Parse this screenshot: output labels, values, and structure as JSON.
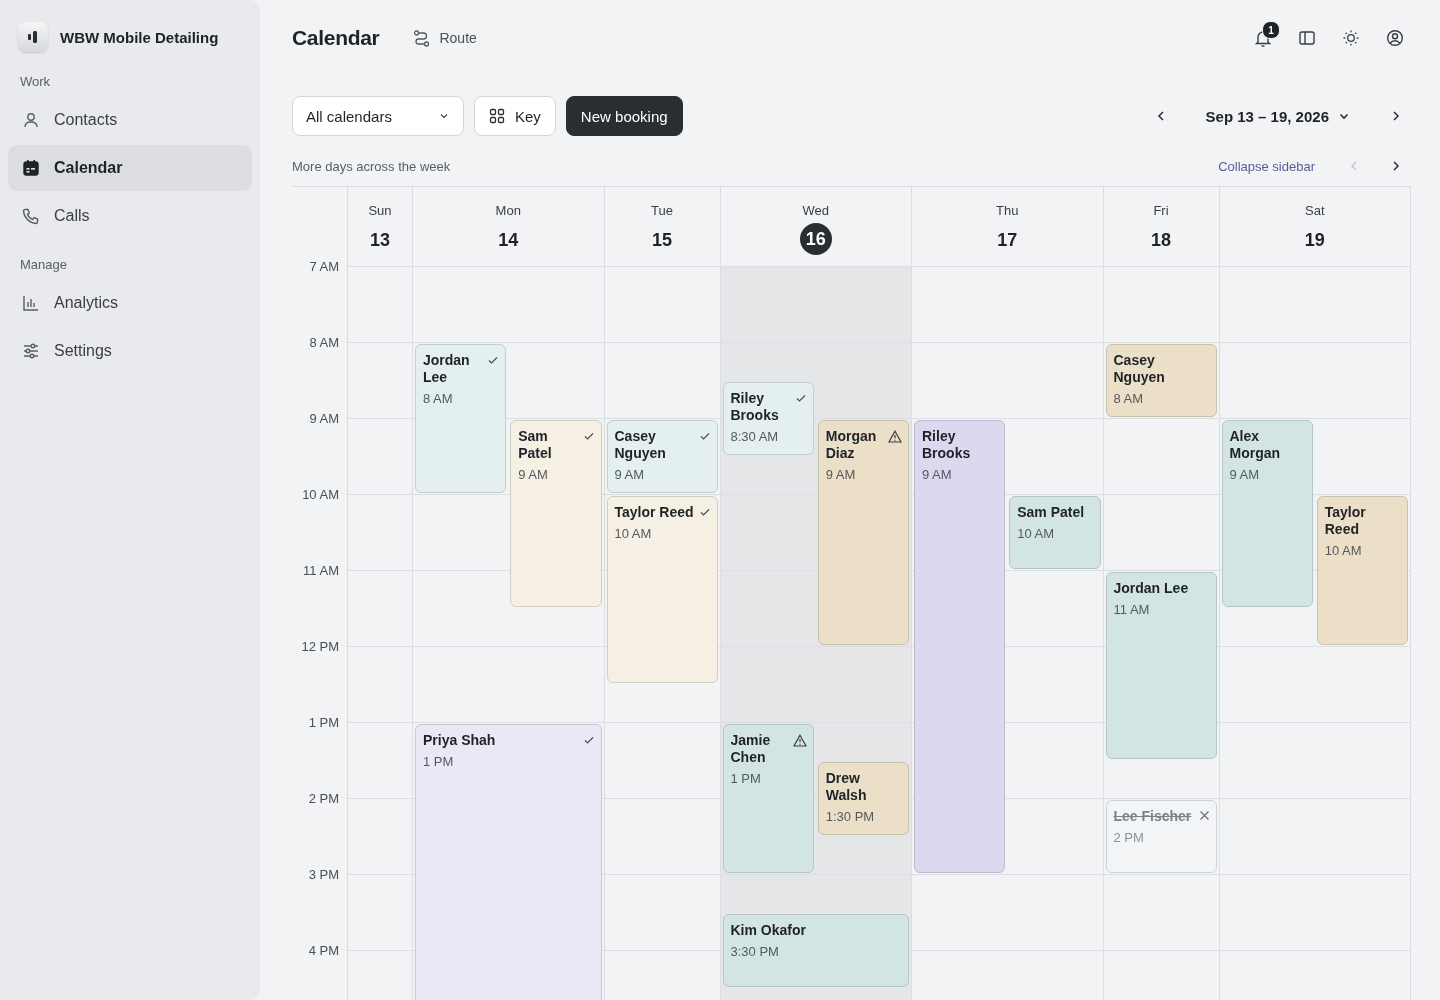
{
  "sidebar": {
    "brand": "WBW Mobile Detailing",
    "sections": [
      {
        "label": "Work",
        "items": [
          {
            "label": "Contacts",
            "selected": false
          },
          {
            "label": "Calendar",
            "selected": true
          },
          {
            "label": "Calls",
            "selected": false
          }
        ]
      },
      {
        "label": "Manage",
        "items": [
          {
            "label": "Analytics",
            "selected": false
          },
          {
            "label": "Settings",
            "selected": false
          }
        ]
      }
    ]
  },
  "header": {
    "title": "Calendar",
    "route_link": "Route",
    "notification_count": "1"
  },
  "toolbar": {
    "calendar_select": "All calendars",
    "key_button": "Key",
    "new_button": "New booking",
    "date_range": "Sep 13 – 19, 2026"
  },
  "subheader": {
    "note": "More days across the week",
    "collapse_link": "Collapse sidebar",
    "prev_disabled": true
  },
  "hours": [
    "7 AM",
    "8 AM",
    "9 AM",
    "10 AM",
    "11 AM",
    "12 PM",
    "1 PM",
    "2 PM",
    "3 PM",
    "4 PM"
  ],
  "days": [
    {
      "weekday": "Sun",
      "date": "13",
      "selected": false
    },
    {
      "weekday": "Mon",
      "date": "14",
      "selected": false,
      "events": [
        {
          "name": "Jordan Lee",
          "time": "8 AM",
          "kind": "confirmed",
          "color": "#e4eff0"
        },
        {
          "name": "Sam Patel",
          "time": "9 AM",
          "kind": "confirmed",
          "color": "#f5efe4"
        },
        {
          "name": "Priya Shah",
          "time": "1 PM",
          "kind": "confirmed",
          "color": "#ebe8f6"
        }
      ]
    },
    {
      "weekday": "Tue",
      "date": "15",
      "selected": false,
      "events": [
        {
          "name": "Casey Nguyen",
          "time": "9 AM",
          "kind": "confirmed",
          "color": "#e4eff0"
        },
        {
          "name": "Taylor Reed",
          "time": "10 AM",
          "kind": "confirmed",
          "color": "#f5efe4"
        }
      ]
    },
    {
      "weekday": "Wed",
      "date": "16",
      "selected": true,
      "events": [
        {
          "name": "Riley Brooks",
          "time": "8:30 AM",
          "kind": "confirmed",
          "color": "#e4eff0"
        },
        {
          "name": "Morgan Diaz",
          "time": "9 AM",
          "kind": "warning",
          "color": "#ecdfc8"
        },
        {
          "name": "Jamie Chen",
          "time": "1 PM",
          "kind": "warning",
          "color": "#d3e5e3"
        },
        {
          "name": "Drew Walsh",
          "time": "1:30 PM",
          "kind": "plain",
          "color": "#ecdfc8"
        },
        {
          "name": "Kim Okafor",
          "time": "3:30 PM",
          "kind": "plain",
          "color": "#d3e5e3"
        }
      ]
    },
    {
      "weekday": "Thu",
      "date": "17",
      "selected": false,
      "events": [
        {
          "name": "Riley Brooks",
          "time": "9 AM",
          "kind": "plain",
          "color": "#ddd7ef"
        },
        {
          "name": "Sam Patel",
          "time": "10 AM",
          "kind": "plain",
          "color": "#d3e5e3"
        }
      ]
    },
    {
      "weekday": "Fri",
      "date": "18",
      "selected": false,
      "events": [
        {
          "name": "Casey Nguyen",
          "time": "8 AM",
          "kind": "plain",
          "color": "#ecdfc8"
        },
        {
          "name": "Jordan Lee",
          "time": "11 AM",
          "kind": "plain",
          "color": "#d3e5e3"
        },
        {
          "name": "Lee Fischer",
          "time": "2 PM",
          "kind": "cancelled",
          "color": "#f3f4f6"
        }
      ]
    },
    {
      "weekday": "Sat",
      "date": "19",
      "selected": false,
      "events": [
        {
          "name": "Alex Morgan",
          "time": "9 AM",
          "kind": "plain",
          "color": "#d3e5e3"
        },
        {
          "name": "Taylor Reed",
          "time": "10 AM",
          "kind": "plain",
          "color": "#ecdfc8"
        }
      ]
    }
  ]
}
